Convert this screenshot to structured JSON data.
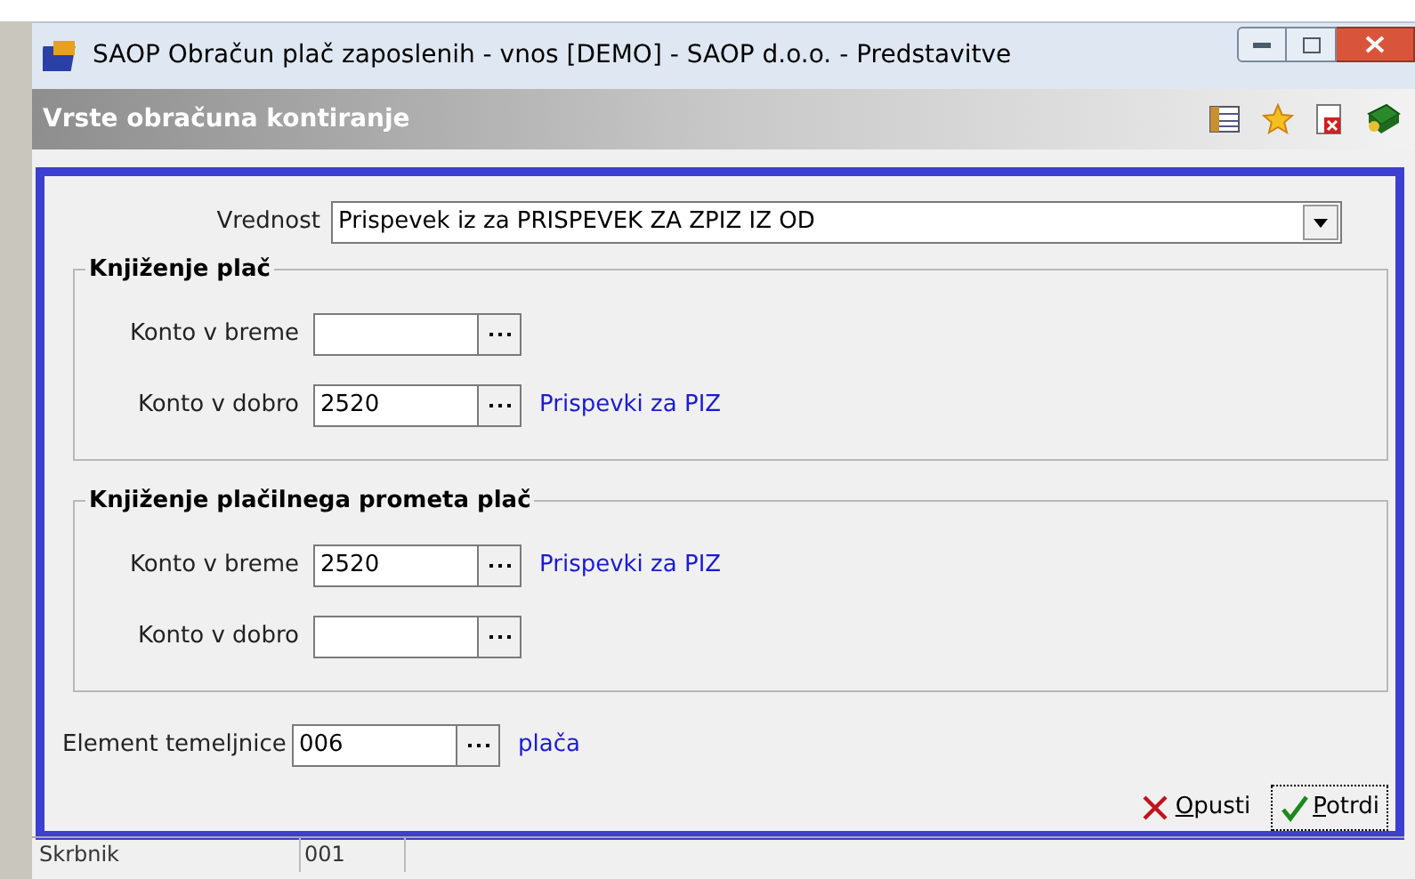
{
  "window": {
    "title": "SAOP Obračun plač zaposlenih - vnos [DEMO] - SAOP d.o.o. - Predstavitve"
  },
  "form": {
    "title": "Vrste obračuna kontiranje"
  },
  "value_field": {
    "label": "Vrednost",
    "value": "Prispevek iz za PRISPEVEK ZA ZPIZ IZ OD"
  },
  "groups": [
    {
      "title": "Knjiženje plač",
      "rows": [
        {
          "label": "Konto v breme"
        },
        {
          "label": "Konto v dobro",
          "value": "2520",
          "link": "Prispevki za PIZ"
        }
      ]
    },
    {
      "title": "Knjiženje plačilnega prometa plač",
      "rows": [
        {
          "label": "Konto v breme",
          "value": "2520",
          "link": "Prispevki za PIZ"
        },
        {
          "label": "Konto v dobro"
        }
      ]
    }
  ],
  "element_row": {
    "label": "Element temeljnice",
    "value": "006",
    "link": "plača"
  },
  "buttons": [
    {
      "label": "Opusti",
      "kind": "cancel",
      "focused": false
    },
    {
      "label": "Potrdi",
      "kind": "confirm",
      "focused": true
    }
  ],
  "status_bar": [
    "Skrbnik",
    "001"
  ]
}
